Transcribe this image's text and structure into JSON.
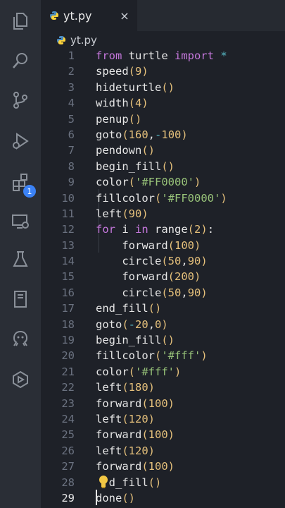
{
  "tab": {
    "filename": "yt.py",
    "close_glyph": "×"
  },
  "breadcrumb": {
    "filename": "yt.py"
  },
  "extensions_badge": "1",
  "code": [
    {
      "n": "1",
      "tokens": [
        [
          "kw",
          "from"
        ],
        [
          "fn",
          " turtle "
        ],
        [
          "kw",
          "import"
        ],
        [
          "op",
          " *"
        ]
      ]
    },
    {
      "n": "2",
      "tokens": [
        [
          "fn",
          "speed"
        ],
        [
          "pn",
          "("
        ],
        [
          "num",
          "9"
        ],
        [
          "pn",
          ")"
        ]
      ]
    },
    {
      "n": "3",
      "tokens": [
        [
          "fn",
          "hideturtle"
        ],
        [
          "pn",
          "()"
        ]
      ]
    },
    {
      "n": "4",
      "tokens": [
        [
          "fn",
          "width"
        ],
        [
          "pn",
          "("
        ],
        [
          "num",
          "4"
        ],
        [
          "pn",
          ")"
        ]
      ]
    },
    {
      "n": "5",
      "tokens": [
        [
          "fn",
          "penup"
        ],
        [
          "pn",
          "()"
        ]
      ]
    },
    {
      "n": "6",
      "tokens": [
        [
          "fn",
          "goto"
        ],
        [
          "pn",
          "("
        ],
        [
          "num",
          "160"
        ],
        [
          "fn",
          ","
        ],
        [
          "op",
          "-"
        ],
        [
          "num",
          "100"
        ],
        [
          "pn",
          ")"
        ]
      ]
    },
    {
      "n": "7",
      "tokens": [
        [
          "fn",
          "pendown"
        ],
        [
          "pn",
          "()"
        ]
      ]
    },
    {
      "n": "8",
      "tokens": [
        [
          "fn",
          "begin_fill"
        ],
        [
          "pn",
          "()"
        ]
      ]
    },
    {
      "n": "9",
      "tokens": [
        [
          "fn",
          "color"
        ],
        [
          "pn",
          "("
        ],
        [
          "str",
          "'#FF0000'"
        ],
        [
          "pn",
          ")"
        ]
      ]
    },
    {
      "n": "10",
      "tokens": [
        [
          "fn",
          "fillcolor"
        ],
        [
          "pn",
          "("
        ],
        [
          "str",
          "'#FF0000'"
        ],
        [
          "pn",
          ")"
        ]
      ]
    },
    {
      "n": "11",
      "tokens": [
        [
          "fn",
          "left"
        ],
        [
          "pn",
          "("
        ],
        [
          "num",
          "90"
        ],
        [
          "pn",
          ")"
        ]
      ]
    },
    {
      "n": "12",
      "tokens": [
        [
          "kw",
          "for"
        ],
        [
          "fn",
          " i "
        ],
        [
          "kw",
          "in"
        ],
        [
          "fn",
          " range"
        ],
        [
          "pn",
          "("
        ],
        [
          "num",
          "2"
        ],
        [
          "pn",
          ")"
        ],
        [
          "fn",
          ":"
        ]
      ]
    },
    {
      "n": "13",
      "tokens": [
        [
          "fn",
          "    forward"
        ],
        [
          "pn",
          "("
        ],
        [
          "num",
          "100"
        ],
        [
          "pn",
          ")"
        ]
      ]
    },
    {
      "n": "14",
      "tokens": [
        [
          "fn",
          "    circle"
        ],
        [
          "pn",
          "("
        ],
        [
          "num",
          "50"
        ],
        [
          "fn",
          ","
        ],
        [
          "num",
          "90"
        ],
        [
          "pn",
          ")"
        ]
      ]
    },
    {
      "n": "15",
      "tokens": [
        [
          "fn",
          "    forward"
        ],
        [
          "pn",
          "("
        ],
        [
          "num",
          "200"
        ],
        [
          "pn",
          ")"
        ]
      ]
    },
    {
      "n": "16",
      "tokens": [
        [
          "fn",
          "    circle"
        ],
        [
          "pn",
          "("
        ],
        [
          "num",
          "50"
        ],
        [
          "fn",
          ","
        ],
        [
          "num",
          "90"
        ],
        [
          "pn",
          ")"
        ]
      ]
    },
    {
      "n": "17",
      "tokens": [
        [
          "fn",
          "end_fill"
        ],
        [
          "pn",
          "()"
        ]
      ]
    },
    {
      "n": "18",
      "tokens": [
        [
          "fn",
          "goto"
        ],
        [
          "pn",
          "("
        ],
        [
          "op",
          "-"
        ],
        [
          "num",
          "20"
        ],
        [
          "fn",
          ","
        ],
        [
          "num",
          "0"
        ],
        [
          "pn",
          ")"
        ]
      ]
    },
    {
      "n": "19",
      "tokens": [
        [
          "fn",
          "begin_fill"
        ],
        [
          "pn",
          "()"
        ]
      ]
    },
    {
      "n": "20",
      "tokens": [
        [
          "fn",
          "fillcolor"
        ],
        [
          "pn",
          "("
        ],
        [
          "str",
          "'#fff'"
        ],
        [
          "pn",
          ")"
        ]
      ]
    },
    {
      "n": "21",
      "tokens": [
        [
          "fn",
          "color"
        ],
        [
          "pn",
          "("
        ],
        [
          "str",
          "'#fff'"
        ],
        [
          "pn",
          ")"
        ]
      ]
    },
    {
      "n": "22",
      "tokens": [
        [
          "fn",
          "left"
        ],
        [
          "pn",
          "("
        ],
        [
          "num",
          "180"
        ],
        [
          "pn",
          ")"
        ]
      ]
    },
    {
      "n": "23",
      "tokens": [
        [
          "fn",
          "forward"
        ],
        [
          "pn",
          "("
        ],
        [
          "num",
          "100"
        ],
        [
          "pn",
          ")"
        ]
      ]
    },
    {
      "n": "24",
      "tokens": [
        [
          "fn",
          "left"
        ],
        [
          "pn",
          "("
        ],
        [
          "num",
          "120"
        ],
        [
          "pn",
          ")"
        ]
      ]
    },
    {
      "n": "25",
      "tokens": [
        [
          "fn",
          "forward"
        ],
        [
          "pn",
          "("
        ],
        [
          "num",
          "100"
        ],
        [
          "pn",
          ")"
        ]
      ]
    },
    {
      "n": "26",
      "tokens": [
        [
          "fn",
          "left"
        ],
        [
          "pn",
          "("
        ],
        [
          "num",
          "120"
        ],
        [
          "pn",
          ")"
        ]
      ]
    },
    {
      "n": "27",
      "tokens": [
        [
          "fn",
          "forward"
        ],
        [
          "pn",
          "("
        ],
        [
          "num",
          "100"
        ],
        [
          "pn",
          ")"
        ]
      ]
    },
    {
      "n": "28",
      "tokens": [
        [
          "fn",
          "  d_fill"
        ],
        [
          "pn",
          "()"
        ]
      ]
    },
    {
      "n": "29",
      "tokens": [
        [
          "fn",
          "done"
        ],
        [
          "pn",
          "()"
        ]
      ],
      "current": true
    }
  ],
  "activity_icons": [
    "explorer-icon",
    "search-icon",
    "source-control-icon",
    "run-debug-icon",
    "extensions-icon",
    "remote-explorer-icon",
    "testing-icon",
    "notebook-icon",
    "github-icon",
    "live-share-icon"
  ],
  "colors": {
    "keyword": "#c678dd",
    "paren": "#e5c07b",
    "string": "#98c379",
    "operator": "#56b6c2",
    "background": "#1e2128",
    "activity_bar": "#2a2e36"
  }
}
